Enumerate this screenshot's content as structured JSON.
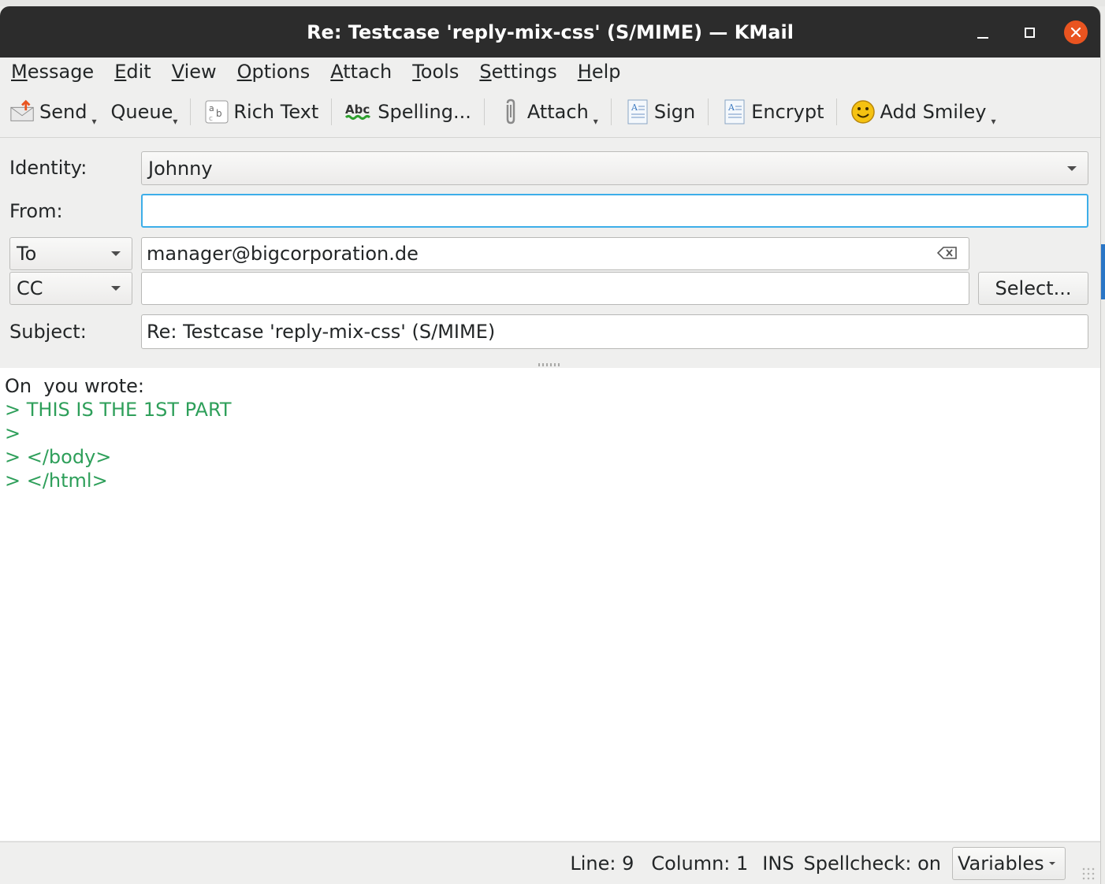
{
  "window": {
    "title": "Re: Testcase 'reply-mix-css' (S/MIME) — KMail"
  },
  "menubar": {
    "items": [
      {
        "label": "Message",
        "mnemonic": "M",
        "rest": "essage"
      },
      {
        "label": "Edit",
        "mnemonic": "E",
        "rest": "dit"
      },
      {
        "label": "View",
        "mnemonic": "V",
        "rest": "iew"
      },
      {
        "label": "Options",
        "mnemonic": "O",
        "rest": "ptions"
      },
      {
        "label": "Attach",
        "mnemonic": "A",
        "rest": "ttach"
      },
      {
        "label": "Tools",
        "mnemonic": "T",
        "rest": "ools"
      },
      {
        "label": "Settings",
        "mnemonic": "S",
        "rest": "ettings"
      },
      {
        "label": "Help",
        "mnemonic": "H",
        "rest": "elp"
      }
    ]
  },
  "toolbar": {
    "send": "Send",
    "queue": "Queue",
    "rich_text": "Rich Text",
    "spelling": "Spelling...",
    "attach": "Attach",
    "sign": "Sign",
    "encrypt": "Encrypt",
    "add_smiley": "Add Smiley"
  },
  "header": {
    "identity_label": "Identity:",
    "identity_value": "Johnny",
    "from_label": "From:",
    "from_value": "",
    "to_type": "To",
    "to_value": "manager@bigcorporation.de",
    "cc_type": "CC",
    "cc_value": "",
    "select_button": "Select...",
    "subject_label": "Subject:",
    "subject_value": "Re: Testcase 'reply-mix-css' (S/MIME)"
  },
  "editor": {
    "intro": "On  you wrote:",
    "quoted_lines": [
      "> THIS IS THE 1ST PART",
      ">",
      "> </body>",
      "> </html>"
    ],
    "colors": {
      "quote": "#2e9f5a"
    }
  },
  "statusbar": {
    "line": "Line: 9",
    "column": "Column: 1",
    "mode": "INS",
    "spellcheck": "Spellcheck: on",
    "variables": "Variables"
  }
}
